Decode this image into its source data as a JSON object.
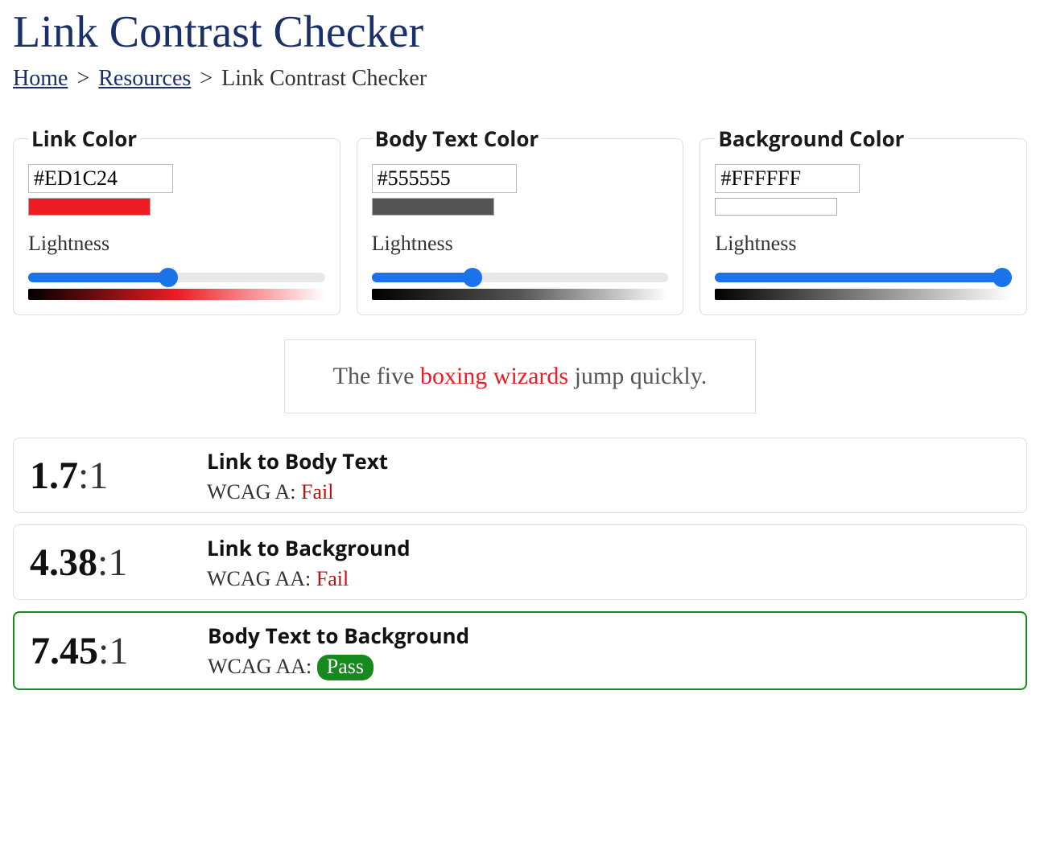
{
  "page": {
    "title": "Link Contrast Checker"
  },
  "breadcrumb": {
    "home": "Home",
    "resources": "Resources",
    "current": "Link Contrast Checker",
    "sep": ">"
  },
  "panels": {
    "link": {
      "legend": "Link Color",
      "hex": "#ED1C24",
      "lightness_label": "Lightness",
      "slider_value": 47,
      "gradient_mid": "#ED1C24"
    },
    "body": {
      "legend": "Body Text Color",
      "hex": "#555555",
      "lightness_label": "Lightness",
      "slider_value": 33,
      "gradient_mid": "#555555"
    },
    "bg": {
      "legend": "Background Color",
      "hex": "#FFFFFF",
      "lightness_label": "Lightness",
      "slider_value": 100,
      "gradient_mid": "#808080"
    }
  },
  "sample": {
    "pre": "The five ",
    "link": "boxing wizards",
    "post": " jump quickly.",
    "body_color": "#555555",
    "link_color": "#ED1C24",
    "bg_color": "#FFFFFF"
  },
  "results": [
    {
      "ratio_num": "1.7",
      "ratio_suffix": ":1",
      "title": "Link to Body Text",
      "wcag_label": "WCAG A: ",
      "status": "Fail",
      "pass": false
    },
    {
      "ratio_num": "4.38",
      "ratio_suffix": ":1",
      "title": "Link to Background",
      "wcag_label": "WCAG AA: ",
      "status": "Fail",
      "pass": false
    },
    {
      "ratio_num": "7.45",
      "ratio_suffix": ":1",
      "title": "Body Text to Background",
      "wcag_label": "WCAG AA: ",
      "status": "Pass",
      "pass": true
    }
  ]
}
